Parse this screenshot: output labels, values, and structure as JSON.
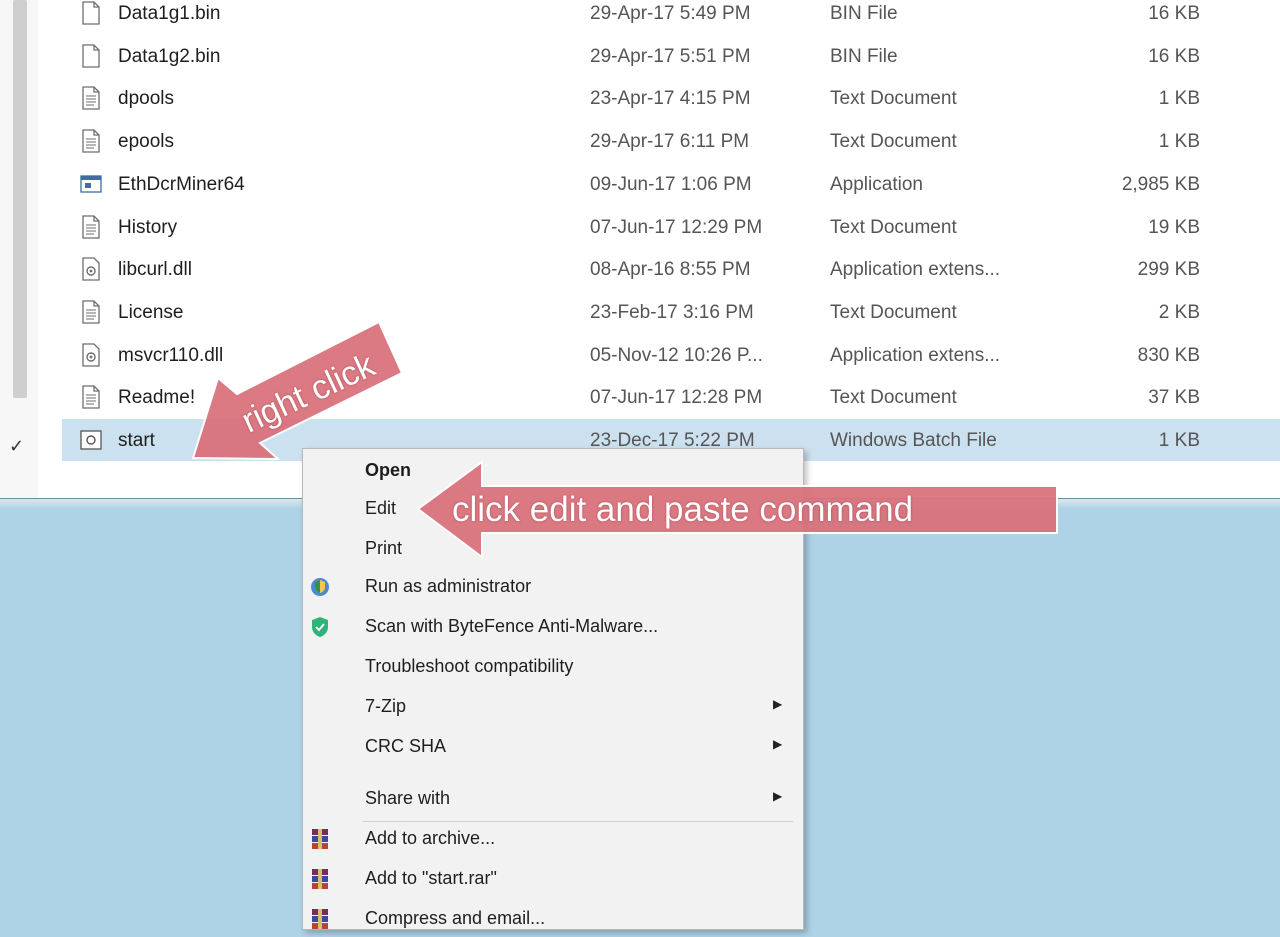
{
  "file_list": {
    "rows": [
      {
        "name": "Data1g1.bin",
        "date": "29-Apr-17 5:49 PM",
        "type": "BIN File",
        "size": "16 KB",
        "icon": "blank-file-icon"
      },
      {
        "name": "Data1g2.bin",
        "date": "29-Apr-17 5:51 PM",
        "type": "BIN File",
        "size": "16 KB",
        "icon": "blank-file-icon"
      },
      {
        "name": "dpools",
        "date": "23-Apr-17 4:15 PM",
        "type": "Text Document",
        "size": "1 KB",
        "icon": "text-file-icon"
      },
      {
        "name": "epools",
        "date": "29-Apr-17 6:11 PM",
        "type": "Text Document",
        "size": "1 KB",
        "icon": "text-file-icon"
      },
      {
        "name": "EthDcrMiner64",
        "date": "09-Jun-17 1:06 PM",
        "type": "Application",
        "size": "2,985 KB",
        "icon": "application-icon"
      },
      {
        "name": "History",
        "date": "07-Jun-17 12:29 PM",
        "type": "Text Document",
        "size": "19 KB",
        "icon": "text-file-icon"
      },
      {
        "name": "libcurl.dll",
        "date": "08-Apr-16 8:55 PM",
        "type": "Application extens...",
        "size": "299 KB",
        "icon": "dll-file-icon"
      },
      {
        "name": "License",
        "date": "23-Feb-17 3:16 PM",
        "type": "Text Document",
        "size": "2 KB",
        "icon": "text-file-icon"
      },
      {
        "name": "msvcr110.dll",
        "date": "05-Nov-12 10:26 P...",
        "type": "Application extens...",
        "size": "830 KB",
        "icon": "dll-file-icon"
      },
      {
        "name": "Readme!",
        "date": "07-Jun-17 12:28 PM",
        "type": "Text Document",
        "size": "37 KB",
        "icon": "text-file-icon"
      },
      {
        "name": "start",
        "date": "23-Dec-17 5:22 PM",
        "type": "Windows Batch File",
        "size": "1 KB",
        "icon": "batch-file-icon",
        "selected": true
      }
    ]
  },
  "context_menu": {
    "items": [
      {
        "label": "Open",
        "bold": true
      },
      {
        "label": "Edit"
      },
      {
        "label": "Print"
      },
      {
        "label": "Run as administrator",
        "icon": "shield-icon"
      },
      {
        "label": "Scan with ByteFence Anti-Malware...",
        "icon": "bytefence-shield-icon"
      },
      {
        "label": "Troubleshoot compatibility"
      },
      {
        "label": "7-Zip",
        "submenu": true
      },
      {
        "label": "CRC SHA",
        "submenu": true
      },
      {
        "label": "Share with",
        "submenu": true
      },
      {
        "label": "Add to archive...",
        "icon": "winrar-archive-icon"
      },
      {
        "label": "Add to \"start.rar\"",
        "icon": "winrar-archive-icon"
      },
      {
        "label": "Compress and email...",
        "icon": "winrar-archive-icon"
      }
    ]
  },
  "annotations": {
    "right_click_label": "right click",
    "edit_label": "click edit and paste command",
    "arrow_color": "#d9707a"
  },
  "colors": {
    "selection": "#cce1ef",
    "desktop_background": "#aed3e6"
  }
}
